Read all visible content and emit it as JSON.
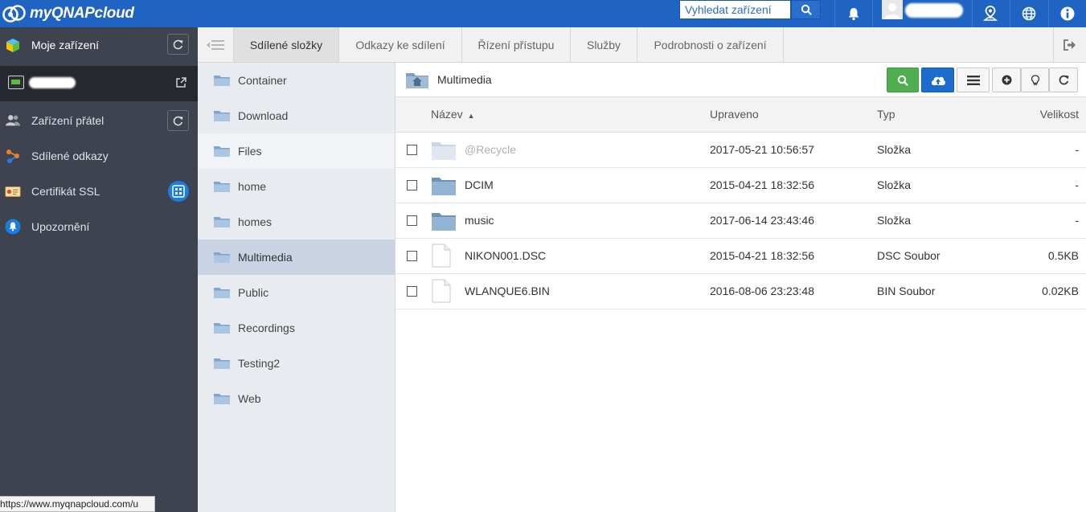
{
  "topbar": {
    "brand": "myQNAPcloud",
    "search_placeholder": "Vyhledat zařízení",
    "icons": [
      "search-icon",
      "bell-icon",
      "user-avatar",
      "location-pin-icon",
      "globe-icon",
      "info-icon"
    ],
    "accent": "#1f64c3"
  },
  "sidebar": {
    "my_devices": "Moje zařízení",
    "friend_devices": "Zařízení přátel",
    "shared_links": "Sdílené odkazy",
    "ssl_certificate": "Certifikát SSL",
    "notifications": "Upozornění",
    "status_url": "https://www.myqnapcloud.com/u"
  },
  "tabs": [
    {
      "label": "Sdílené složky",
      "active": true
    },
    {
      "label": "Odkazy ke sdílení",
      "active": false
    },
    {
      "label": "Řízení přístupu",
      "active": false
    },
    {
      "label": "Služby",
      "active": false
    },
    {
      "label": "Podrobnosti o zařízení",
      "active": false
    }
  ],
  "folders": [
    {
      "label": "Container"
    },
    {
      "label": "Download"
    },
    {
      "label": "Files"
    },
    {
      "label": "home"
    },
    {
      "label": "homes"
    },
    {
      "label": "Multimedia"
    },
    {
      "label": "Public"
    },
    {
      "label": "Recordings"
    },
    {
      "label": "Testing2"
    },
    {
      "label": "Web"
    }
  ],
  "main": {
    "current_path": "Multimedia",
    "columns": {
      "name": "Název",
      "modified": "Upraveno",
      "type": "Typ",
      "size": "Velikost"
    },
    "sort": {
      "column": "name",
      "direction": "asc"
    },
    "rows": [
      {
        "name": "@Recycle",
        "modified": "2017-05-21 10:56:57",
        "type": "Složka",
        "size": "-",
        "kind": "folder-dim"
      },
      {
        "name": "DCIM",
        "modified": "2015-04-21 18:32:56",
        "type": "Složka",
        "size": "-",
        "kind": "folder"
      },
      {
        "name": "music",
        "modified": "2017-06-14 23:43:46",
        "type": "Složka",
        "size": "-",
        "kind": "folder"
      },
      {
        "name": "NIKON001.DSC",
        "modified": "2015-04-21 18:32:56",
        "type": "DSC Soubor",
        "size": "0.5KB",
        "kind": "file"
      },
      {
        "name": "WLANQUE6.BIN",
        "modified": "2016-08-06 23:23:48",
        "type": "BIN Soubor",
        "size": "0.02KB",
        "kind": "file"
      }
    ]
  }
}
